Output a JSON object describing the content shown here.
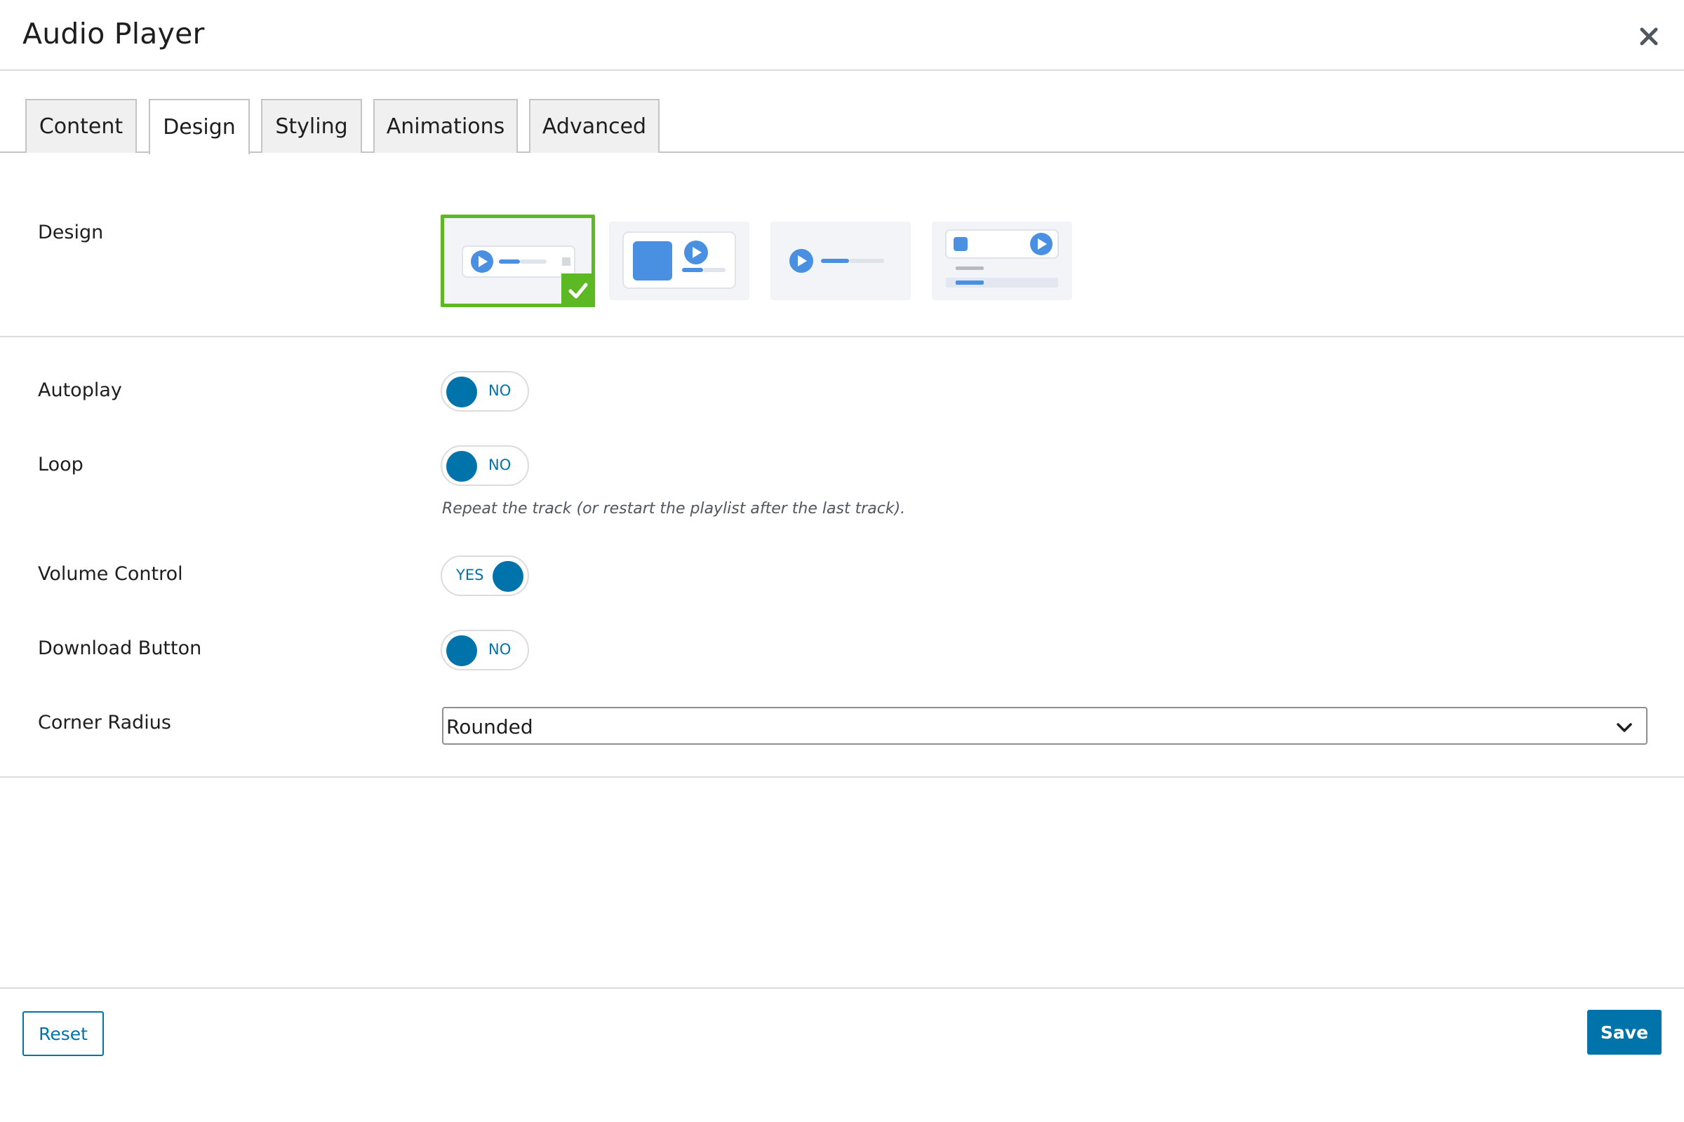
{
  "modal": {
    "title": "Audio Player",
    "close_icon": "close-icon"
  },
  "tabs": [
    {
      "label": "Content",
      "active": false
    },
    {
      "label": "Design",
      "active": true
    },
    {
      "label": "Styling",
      "active": false
    },
    {
      "label": "Animations",
      "active": false
    },
    {
      "label": "Advanced",
      "active": false
    }
  ],
  "design": {
    "label": "Design",
    "selected_index": 0,
    "options": [
      {
        "icon": "player-compact-preview-icon"
      },
      {
        "icon": "player-cover-art-preview-icon"
      },
      {
        "icon": "player-minimal-preview-icon"
      },
      {
        "icon": "player-playlist-preview-icon"
      }
    ]
  },
  "settings": {
    "autoplay": {
      "label": "Autoplay",
      "value": "NO"
    },
    "loop": {
      "label": "Loop",
      "value": "NO",
      "help": "Repeat the track (or restart the playlist after the last track)."
    },
    "volume_control": {
      "label": "Volume Control",
      "value": "YES"
    },
    "download_button": {
      "label": "Download Button",
      "value": "NO"
    },
    "corner_radius": {
      "label": "Corner Radius",
      "value": "Rounded"
    }
  },
  "footer": {
    "reset_label": "Reset",
    "save_label": "Save"
  },
  "colors": {
    "accent": "#0073aa",
    "selected": "#5cb924",
    "preview_blue": "#4a90e2"
  }
}
